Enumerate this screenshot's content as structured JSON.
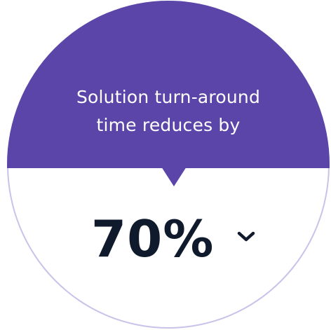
{
  "card": {
    "headline_line1": "Solution turn-around",
    "headline_line2": "time reduces by",
    "value": "70%",
    "toggle_icon": "chevron-down-icon"
  },
  "colors": {
    "accent": "#5c45a8",
    "value_text": "#0f1b2d",
    "ring": "#c9c2ea"
  }
}
